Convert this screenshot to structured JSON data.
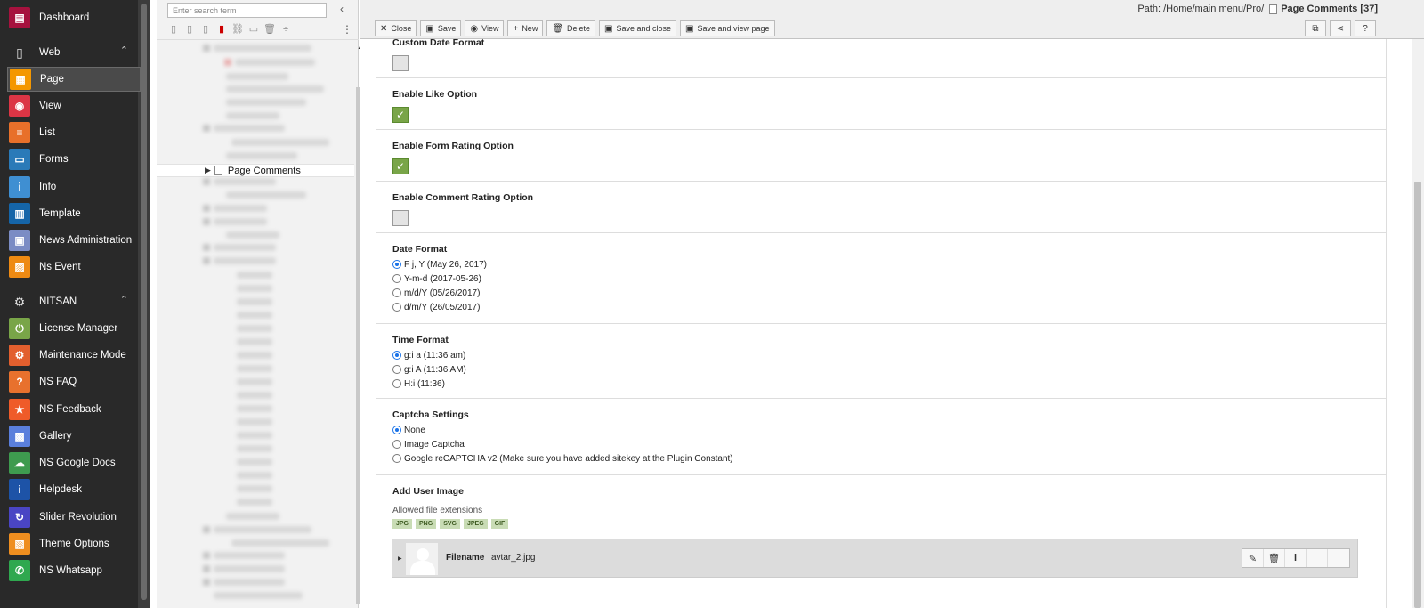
{
  "module_menu": {
    "items": [
      {
        "label": "Dashboard",
        "icon": "dashboard-icon",
        "color": "#a6123e",
        "glyph": "▤"
      },
      {
        "label": "Page",
        "icon": "page-icon",
        "color": "#f49700",
        "glyph": "▦",
        "active": true
      },
      {
        "label": "View",
        "icon": "view-eye-icon",
        "color": "#dc3545",
        "glyph": "◉"
      },
      {
        "label": "List",
        "icon": "list-icon",
        "color": "#e8702a",
        "glyph": "≡"
      },
      {
        "label": "Forms",
        "icon": "forms-icon",
        "color": "#2a7ab8",
        "glyph": "▭"
      },
      {
        "label": "Info",
        "icon": "info-icon",
        "color": "#3f8fd2",
        "glyph": "i"
      },
      {
        "label": "Template",
        "icon": "template-icon",
        "color": "#1565a8",
        "glyph": "▥"
      },
      {
        "label": "News Administration",
        "icon": "news-icon",
        "color": "#7b8cc4",
        "glyph": "▣"
      },
      {
        "label": "Ns Event",
        "icon": "calendar-icon",
        "color": "#ee8a13",
        "glyph": "▨"
      }
    ],
    "group_web": "Web",
    "group_nitsan": "NITSAN",
    "nitsan_items": [
      {
        "label": "License Manager",
        "icon": "power-icon",
        "color": "#79a548",
        "glyph": "⏻"
      },
      {
        "label": "Maintenance Mode",
        "icon": "gear-icon",
        "color": "#e25f2e",
        "glyph": "⚙"
      },
      {
        "label": "NS FAQ",
        "icon": "faq-icon",
        "color": "#e8712d",
        "glyph": "?"
      },
      {
        "label": "NS Feedback",
        "icon": "star-icon",
        "color": "#ef5b29",
        "glyph": "★"
      },
      {
        "label": "Gallery",
        "icon": "gallery-icon",
        "color": "#5a7fdc",
        "glyph": "▩"
      },
      {
        "label": "NS Google Docs",
        "icon": "cloud-icon",
        "color": "#3e9b4f",
        "glyph": "☁"
      },
      {
        "label": "Helpdesk",
        "icon": "helpdesk-icon",
        "color": "#1d53a7",
        "glyph": "i"
      },
      {
        "label": "Slider Revolution",
        "icon": "refresh-icon",
        "color": "#4a45c4",
        "glyph": "↻"
      },
      {
        "label": "Theme Options",
        "icon": "box-icon",
        "color": "#ef8e1f",
        "glyph": "▧"
      },
      {
        "label": "NS Whatsapp",
        "icon": "whatsapp-icon",
        "color": "#2fa84f",
        "glyph": "✆"
      }
    ]
  },
  "tree": {
    "search_placeholder": "Enter search term",
    "selected_label": "Page Comments"
  },
  "header": {
    "path_label": "Path: /Home/main menu/Pro/",
    "path_page": "Page Comments [37]",
    "buttons": {
      "close": "Close",
      "save": "Save",
      "view": "View",
      "new": "New",
      "delete": "Delete",
      "save_close": "Save and close",
      "save_view": "Save and view page"
    }
  },
  "form": {
    "custom_date_label": "Custom Date Format",
    "like_label": "Enable Like Option",
    "form_rating_label": "Enable Form Rating Option",
    "comment_rating_label": "Enable Comment Rating Option",
    "date_format": {
      "label": "Date Format",
      "options": [
        "F j, Y (May 26, 2017)",
        "Y-m-d (2017-05-26)",
        "m/d/Y (05/26/2017)",
        "d/m/Y (26/05/2017)"
      ]
    },
    "time_format": {
      "label": "Time Format",
      "options": [
        "g:i a (11:36 am)",
        "g:i A (11:36 AM)",
        "H:i (11:36)"
      ]
    },
    "captcha": {
      "label": "Captcha Settings",
      "options": [
        "None",
        "Image Captcha",
        "Google reCAPTCHA v2 (Make sure you have added sitekey at the Plugin Constant)"
      ]
    },
    "user_image": {
      "label": "Add User Image",
      "allowed_label": "Allowed file extensions",
      "extensions": [
        "JPG",
        "PNG",
        "SVG",
        "JPEG",
        "GIF"
      ],
      "filename_label": "Filename",
      "filename_value": "avtar_2.jpg"
    }
  }
}
